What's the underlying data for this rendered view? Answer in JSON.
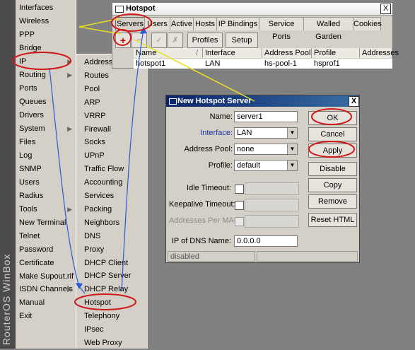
{
  "brand": "RouterOS WinBox",
  "main_menu": {
    "items": [
      {
        "label": "Interfaces",
        "arrow": false
      },
      {
        "label": "Wireless",
        "arrow": false
      },
      {
        "label": "PPP",
        "arrow": false
      },
      {
        "label": "Bridge",
        "arrow": false
      },
      {
        "label": "IP",
        "arrow": true
      },
      {
        "label": "Routing",
        "arrow": true
      },
      {
        "label": "Ports",
        "arrow": false
      },
      {
        "label": "Queues",
        "arrow": false
      },
      {
        "label": "Drivers",
        "arrow": false
      },
      {
        "label": "System",
        "arrow": true
      },
      {
        "label": "Files",
        "arrow": false
      },
      {
        "label": "Log",
        "arrow": false
      },
      {
        "label": "SNMP",
        "arrow": false
      },
      {
        "label": "Users",
        "arrow": false
      },
      {
        "label": "Radius",
        "arrow": false
      },
      {
        "label": "Tools",
        "arrow": true
      },
      {
        "label": "New Terminal",
        "arrow": false
      },
      {
        "label": "Telnet",
        "arrow": false
      },
      {
        "label": "Password",
        "arrow": false
      },
      {
        "label": "Certificate",
        "arrow": false
      },
      {
        "label": "Make Supout.rif",
        "arrow": false
      },
      {
        "label": "ISDN Channels",
        "arrow": true
      },
      {
        "label": "Manual",
        "arrow": false
      },
      {
        "label": "Exit",
        "arrow": false
      }
    ]
  },
  "ip_submenu": {
    "items": [
      "Addresses",
      "Routes",
      "Pool",
      "ARP",
      "VRRP",
      "Firewall",
      "Socks",
      "UPnP",
      "Traffic Flow",
      "Accounting",
      "Services",
      "Packing",
      "Neighbors",
      "DNS",
      "Proxy",
      "DHCP Client",
      "DHCP Server",
      "DHCP Relay",
      "Hotspot",
      "Telephony",
      "IPsec",
      "Web Proxy"
    ]
  },
  "hotspot_window": {
    "title": "Hotspot",
    "close_glyph": "X",
    "tabs": [
      "Servers",
      "Users",
      "Active",
      "Hosts",
      "IP Bindings",
      "Service Ports",
      "Walled Garden",
      "Cookies"
    ],
    "toolbar": {
      "add_glyph": "+",
      "remove_glyph": "−",
      "enable_glyph": "✓",
      "disable_glyph": "✗",
      "profiles_label": "Profiles",
      "setup_label": "Setup"
    },
    "columns": [
      "Name",
      "Interface",
      "Address Pool",
      "Profile",
      "Addresses"
    ],
    "sort_glyph": "/",
    "rows": [
      {
        "name": "hotspot1",
        "interface": "LAN",
        "pool": "hs-pool-1",
        "profile": "hsprof1",
        "addresses": ""
      }
    ]
  },
  "dialog": {
    "title": "New Hotspot Server",
    "close_glyph": "X",
    "name_label": "Name:",
    "name_value": "server1",
    "interface_label": "Interface:",
    "interface_value": "LAN",
    "pool_label": "Address Pool:",
    "pool_value": "none",
    "profile_label": "Profile:",
    "profile_value": "default",
    "idle_label": "Idle Timeout:",
    "keepalive_label": "Keepalive Timeout:",
    "per_mac_label": "Addresses Per MAC:",
    "dns_label": "IP of DNS Name:",
    "dns_value": "0.0.0.0",
    "status_text": "disabled",
    "buttons": {
      "ok": "OK",
      "cancel": "Cancel",
      "apply": "Apply",
      "disable": "Disable",
      "copy": "Copy",
      "remove": "Remove",
      "reset_html": "Reset HTML"
    }
  },
  "colors": {
    "accent_ring": "#d01818",
    "arrow_blue": "#2a5bd7",
    "arrow_yellow": "#e8e020",
    "interface_label": "#1c32a8"
  }
}
